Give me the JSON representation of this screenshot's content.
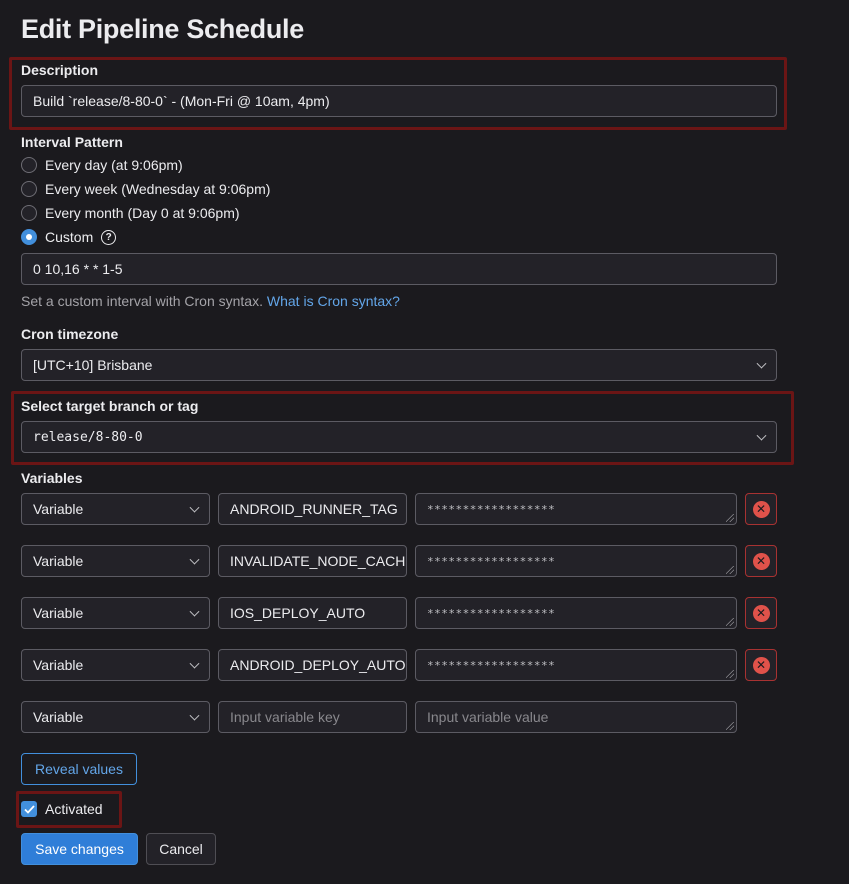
{
  "title": "Edit Pipeline Schedule",
  "description": {
    "label": "Description",
    "value": "Build `release/8-80-0` - (Mon-Fri @ 10am, 4pm)"
  },
  "interval": {
    "label": "Interval Pattern",
    "options": [
      {
        "label": "Every day (at 9:06pm)",
        "checked": false
      },
      {
        "label": "Every week (Wednesday at 9:06pm)",
        "checked": false
      },
      {
        "label": "Every month (Day 0 at 9:06pm)",
        "checked": false
      },
      {
        "label": "Custom",
        "checked": true
      }
    ],
    "custom_value": "0 10,16 * * 1-5",
    "help_text": "Set a custom interval with Cron syntax.",
    "help_link": "What is Cron syntax?"
  },
  "timezone": {
    "label": "Cron timezone",
    "value": "[UTC+10] Brisbane"
  },
  "target": {
    "label": "Select target branch or tag",
    "value": "release/8-80-0"
  },
  "variables": {
    "label": "Variables",
    "rows": [
      {
        "type": "Variable",
        "key": "ANDROID_RUNNER_TAG",
        "value": "******************"
      },
      {
        "type": "Variable",
        "key": "INVALIDATE_NODE_CACHE",
        "value": "******************"
      },
      {
        "type": "Variable",
        "key": "IOS_DEPLOY_AUTO",
        "value": "******************"
      },
      {
        "type": "Variable",
        "key": "ANDROID_DEPLOY_AUTO",
        "value": "******************"
      }
    ],
    "empty_row": {
      "type": "Variable",
      "key_placeholder": "Input variable key",
      "value_placeholder": "Input variable value"
    },
    "reveal_label": "Reveal values"
  },
  "activated": {
    "label": "Activated",
    "checked": true
  },
  "actions": {
    "save": "Save changes",
    "cancel": "Cancel"
  },
  "colors": {
    "accent": "#428fdc",
    "danger": "#e0524a",
    "highlight": "#6b1515",
    "background": "#1b1a1e"
  }
}
